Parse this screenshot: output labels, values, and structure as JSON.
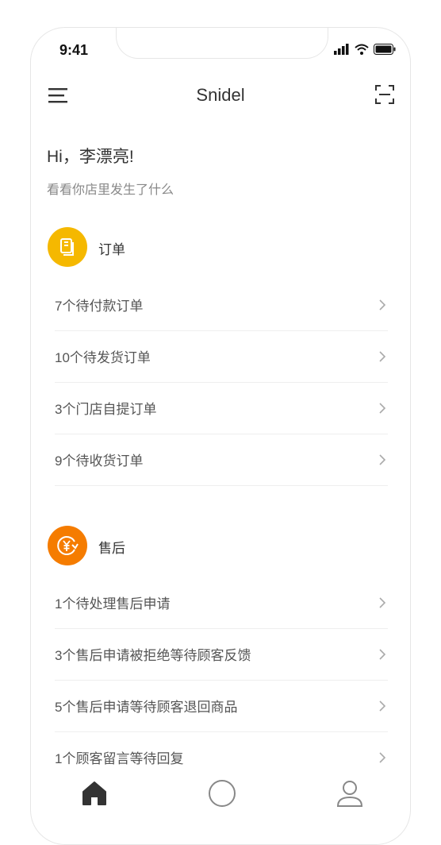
{
  "status_bar": {
    "time": "9:41"
  },
  "header": {
    "title": "Snidel",
    "menu_icon": "menu-icon",
    "scan_icon": "scan-icon"
  },
  "greeting": {
    "title": "Hi，李漂亮!",
    "subtitle": "看看你店里发生了什么"
  },
  "sections": [
    {
      "title": "订单",
      "icon": "order-document-icon",
      "color": "#F5B800",
      "items": [
        {
          "label": "7个待付款订单"
        },
        {
          "label": "10个待发货订单"
        },
        {
          "label": "3个门店自提订单"
        },
        {
          "label": "9个待收货订单"
        }
      ]
    },
    {
      "title": "售后",
      "icon": "yen-refund-icon",
      "color": "#F57C00",
      "items": [
        {
          "label": "1个待处理售后申请"
        },
        {
          "label": "3个售后申请被拒绝等待顾客反馈"
        },
        {
          "label": "5个售后申请等待顾客退回商品"
        },
        {
          "label": "1个顾客留言等待回复"
        }
      ]
    }
  ],
  "tabbar": {
    "tabs": [
      "home-icon",
      "circle-icon",
      "profile-icon"
    ]
  }
}
